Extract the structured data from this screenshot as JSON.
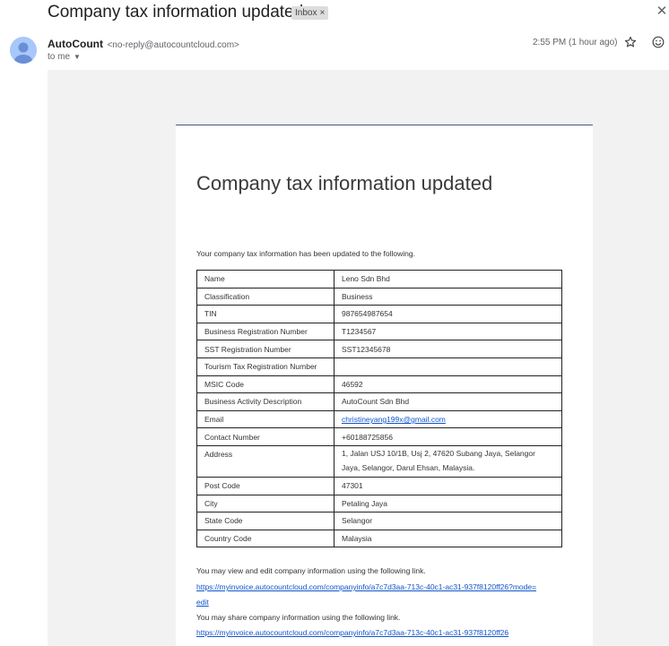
{
  "header": {
    "subject": "Company tax information updated",
    "label_chip": "Inbox",
    "label_chip_close": "×",
    "close": "✕"
  },
  "message": {
    "sender_name": "AutoCount",
    "sender_email": "<no-reply@autocountcloud.com>",
    "recipient": "to me",
    "caret": "▼",
    "time": "2:55 PM (1 hour ago)"
  },
  "icons": {
    "avatar": "person-icon",
    "star": "star-icon",
    "emoji": "emoji-icon"
  },
  "colors": {
    "link": "#1155cc",
    "avatar_bg": "#a8c7fa",
    "card_rule": "#445a78"
  },
  "email": {
    "title": "Company tax information updated",
    "intro": "Your company tax information has been updated to the following.",
    "rows": [
      {
        "label": "Name",
        "value": "Leno Sdn Bhd"
      },
      {
        "label": "Classification",
        "value": "Business"
      },
      {
        "label": "TIN",
        "value": "987654987654"
      },
      {
        "label": "Business Registration Number",
        "value": "T1234567"
      },
      {
        "label": "SST Registration Number",
        "value": "SST12345678"
      },
      {
        "label": "Tourism Tax Registration Number",
        "value": ""
      },
      {
        "label": "MSIC Code",
        "value": "46592"
      },
      {
        "label": "Business Activity Description",
        "value": "AutoCount Sdn Bhd"
      },
      {
        "label": "Email",
        "value": "christineyang199x@gmail.com"
      },
      {
        "label": "Contact Number",
        "value": "+60188725856"
      },
      {
        "label": "Address",
        "value": "1, Jalan USJ 10/1B, Usj 2, 47620 Subang Jaya, Selangor Jaya, Selangor, Darul Ehsan, Malaysia."
      },
      {
        "label": "Post Code",
        "value": "47301"
      },
      {
        "label": "City",
        "value": "Petaling Jaya"
      },
      {
        "label": "State Code",
        "value": "Selangor"
      },
      {
        "label": "Country Code",
        "value": "Malaysia"
      }
    ],
    "edit_text": "You may view and edit company information using the following link.",
    "edit_link_line1": "https://myinvoice.autocountcloud.com/companyinfo/a7c7d3aa-713c-40c1-ac31-937f8120ff26?mode=",
    "edit_link_line2": "edit",
    "share_text": "You may share company information using the following link.",
    "share_link": "https://myinvoice.autocountcloud.com/companyinfo/a7c7d3aa-713c-40c1-ac31-937f8120ff26"
  }
}
